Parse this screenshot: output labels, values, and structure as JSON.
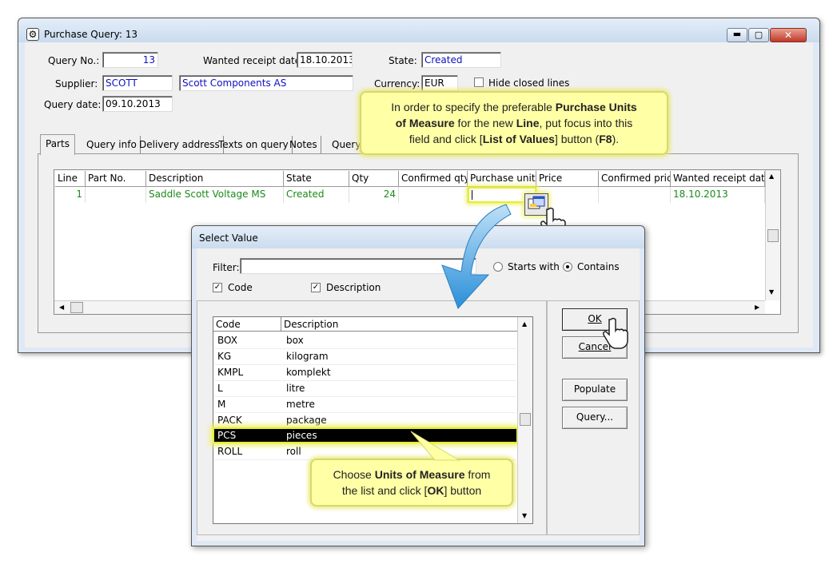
{
  "main_window": {
    "title": "Purchase Query: 13",
    "query_no_label": "Query No.:",
    "query_no": "13",
    "wanted_date_label": "Wanted receipt date:",
    "wanted_date": "18.10.2013",
    "state_label": "State:",
    "state": "Created",
    "supplier_label": "Supplier:",
    "supplier_code": "SCOTT",
    "supplier_name": "Scott Components AS",
    "currency_label": "Currency:",
    "currency": "EUR",
    "hide_closed_label": "Hide closed lines",
    "query_date_label": "Query date:",
    "query_date": "09.10.2013",
    "tabs": [
      "Parts",
      "Query info",
      "Delivery address",
      "Texts on query",
      "Notes",
      "Query"
    ],
    "grid": {
      "headers": [
        "Line",
        "Part No.",
        "Description",
        "State",
        "Qty",
        "Confirmed qty",
        "Purchase unit",
        "Price",
        "Confirmed price",
        "Wanted receipt date"
      ],
      "row": {
        "line": "1",
        "part_no": "",
        "description": "Saddle Scott Voltage MS",
        "state": "Created",
        "qty": "24",
        "confirmed_qty": "",
        "purchase_unit": "",
        "price": "",
        "confirmed_price": "",
        "wanted_date": "18.10.2013"
      }
    }
  },
  "callout_top": {
    "line1_a": "In order to specify the preferable ",
    "line1_b": "Purchase Units",
    "line2_a": "of Measure",
    "line2_b": " for the new ",
    "line2_c": "Line",
    "line2_d": ", put focus into this",
    "line3_a": "field and click [",
    "line3_b": "List of Values",
    "line3_c": "] button (",
    "line3_d": "F8",
    "line3_e": ")."
  },
  "select_dialog": {
    "title": "Select Value",
    "filter_label": "Filter:",
    "filter_value": "",
    "starts_with_label": "Starts with",
    "contains_label": "Contains",
    "code_check_label": "Code",
    "description_check_label": "Description",
    "columns": [
      "Code",
      "Description"
    ],
    "rows": [
      {
        "code": "BOX",
        "description": "box"
      },
      {
        "code": "KG",
        "description": "kilogram"
      },
      {
        "code": "KMPL",
        "description": "komplekt"
      },
      {
        "code": "L",
        "description": "litre"
      },
      {
        "code": "M",
        "description": "metre"
      },
      {
        "code": "PACK",
        "description": "package"
      },
      {
        "code": "PCS",
        "description": "pieces"
      },
      {
        "code": "ROLL",
        "description": "roll"
      }
    ],
    "ok_label": "OK",
    "cancel_label": "Cancel",
    "populate_label": "Populate",
    "query_label": "Query..."
  },
  "callout_bottom": {
    "line1_a": "Choose ",
    "line1_b": "Units of Measure",
    "line1_c": " from",
    "line2_a": "the list and click [",
    "line2_b": "OK",
    "line2_c": "] button"
  },
  "colors": {
    "accent_blue": "#1010c0",
    "grid_green": "#1a8a1a",
    "callout_yellow": "#ffffa6",
    "highlight_glow": "#e8f020",
    "selected_row": "#000000"
  }
}
